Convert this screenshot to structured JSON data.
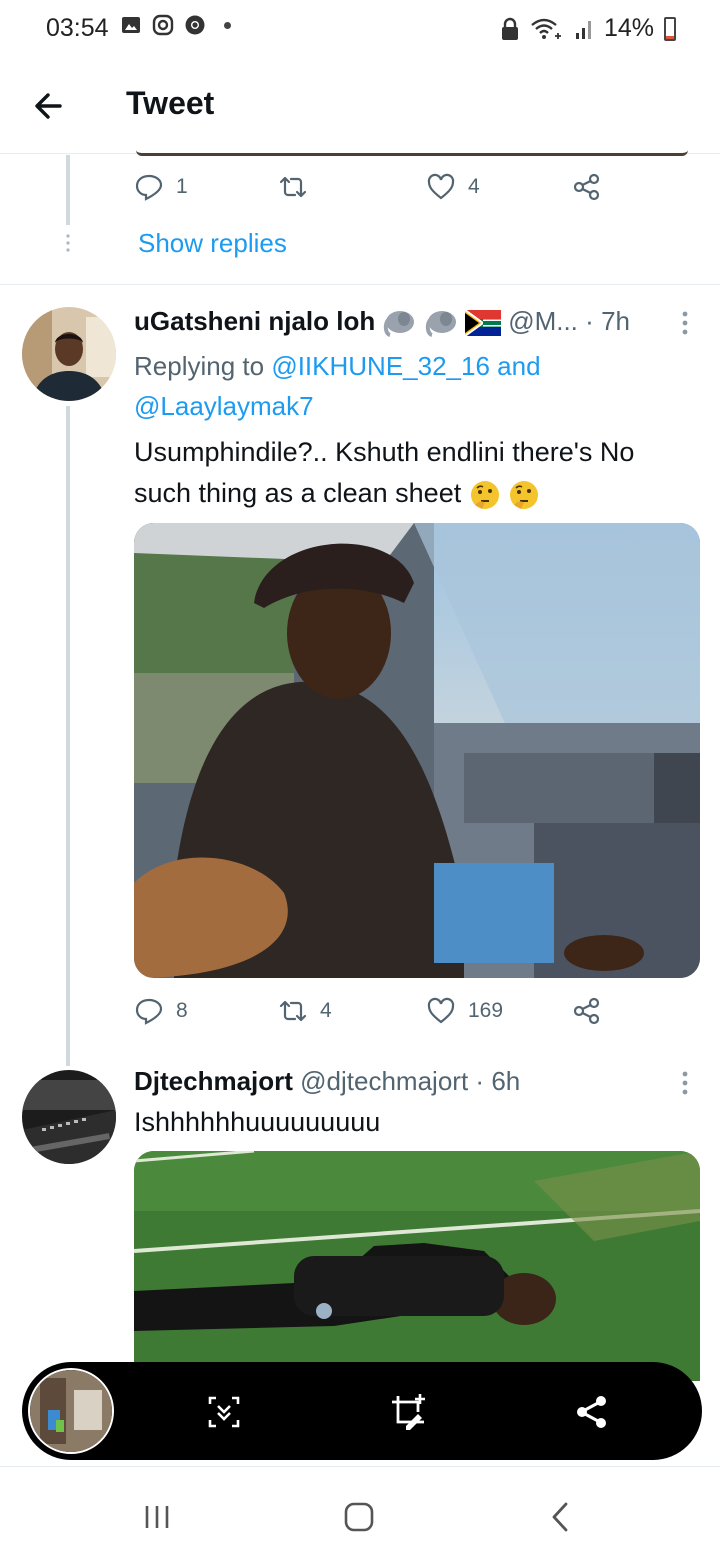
{
  "status_bar": {
    "time": "03:54",
    "battery": "14%",
    "battery_level": 0.14,
    "icons_left": [
      "gallery-icon",
      "instagram-icon",
      "chrome-icon",
      "dot-icon"
    ],
    "icons_right": [
      "lock-icon",
      "wifi-icon",
      "signal-icon",
      "battery-icon"
    ]
  },
  "header": {
    "back_icon": "arrow-left-icon",
    "title": "Tweet"
  },
  "prev_tweet": {
    "reply_count": "1",
    "retweet_count": "",
    "like_count": "4",
    "show_replies": "Show replies"
  },
  "tweet1": {
    "name": "uGatsheni njalo loh",
    "name_emojis": [
      "elephant-emoji",
      "elephant-emoji",
      "south-africa-flag-emoji"
    ],
    "handle": "@M...",
    "separator": "·",
    "time": "7h",
    "replying_prefix": "Replying to",
    "replying_user1": "@IIKHUNE_32_16",
    "replying_and": "and",
    "replying_user2": "@Laaylaymak7",
    "text": "Usumphindile?.. Kshuth endlini there's No such thing as a clean sheet",
    "text_emojis": [
      "thinking-face-emoji",
      "thinking-face-emoji"
    ],
    "reply_count": "8",
    "retweet_count": "4",
    "like_count": "169"
  },
  "tweet2": {
    "name": "Djtechmajort",
    "handle": "@djtechmajort",
    "separator": "·",
    "time": "6h",
    "text": "Ishhhhhhuuuuuuuuu"
  },
  "screenshot_toolbar": {
    "buttons": [
      "scroll-capture-icon",
      "crop-edit-icon",
      "share-icon"
    ]
  },
  "navbar": {
    "buttons": [
      "recent-apps-icon",
      "home-icon",
      "back-icon"
    ]
  },
  "colors": {
    "accent": "#1d9bf0",
    "text_primary": "#0f1419",
    "text_secondary": "#536471",
    "divider": "#e6ecf0"
  }
}
